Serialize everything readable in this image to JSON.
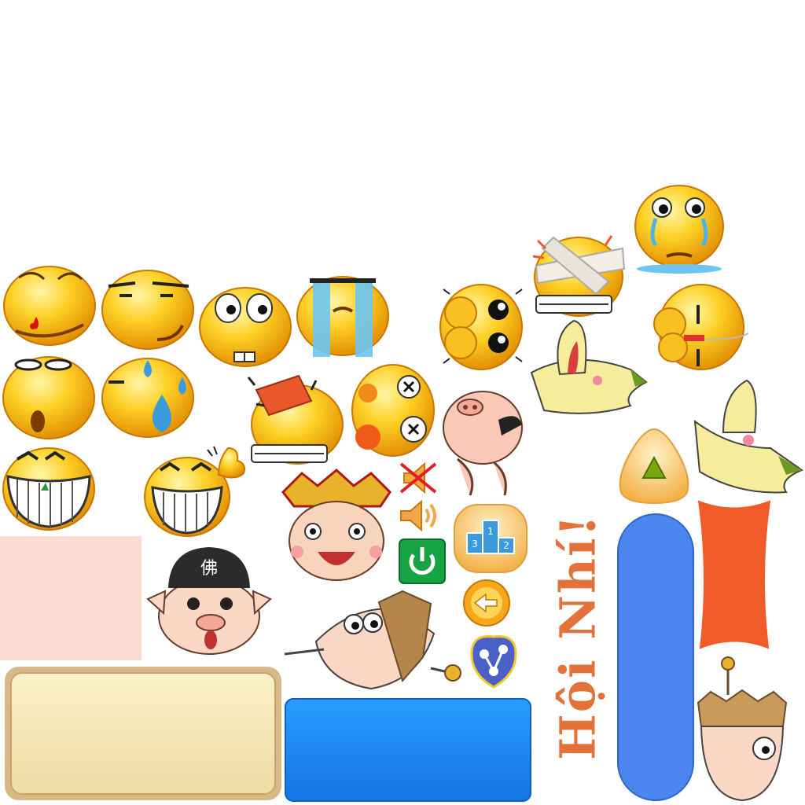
{
  "sprite_sheet": {
    "banner_text": "Hội Nhí!",
    "emoji_icons": [
      "nosebleed-face-icon",
      "squint-face-icon",
      "bucktooth-face-icon",
      "crying-face-icon",
      "shy-cat-face-icon",
      "bandaged-face-icon",
      "tearful-face-icon",
      "shocked-face-icon",
      "sweat-drop-face-icon",
      "brick-hit-face-icon",
      "dizzy-face-icon",
      "peeking-face-icon",
      "grin-face-icon",
      "thumbs-up-grin-face-icon"
    ],
    "button_icons": [
      "mute-speaker-icon",
      "speaker-icon",
      "power-icon",
      "podium-icon",
      "back-arrow-icon",
      "share-icon",
      "play-triangle-icon"
    ],
    "colors": {
      "emoji_yellow": "#f6b60c",
      "accent_orange": "#f15a29",
      "button_blue": "#1e8cf5",
      "bar_blue": "#4a86ee",
      "power_green": "#16a344",
      "scroll_parchment": "#f5e6b8",
      "blush_pink": "#fbdcd0"
    }
  }
}
